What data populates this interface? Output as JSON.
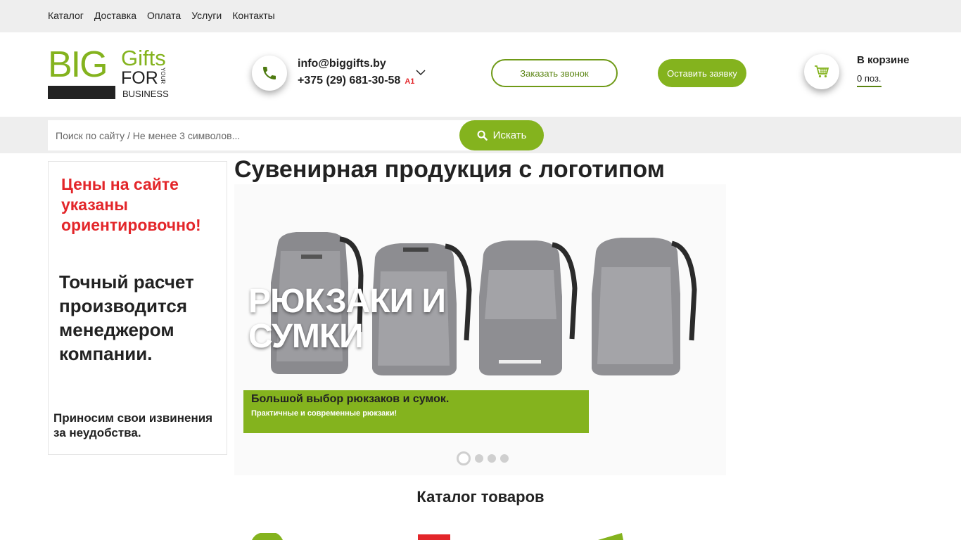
{
  "topnav": {
    "items": [
      "Каталог",
      "Доставка",
      "Оплата",
      "Услуги",
      "Контакты"
    ]
  },
  "logo": {
    "big": "BIG",
    "gifts": "Gifts",
    "for": "FOR",
    "your": "YOUR",
    "business": "BUSINESS"
  },
  "contact": {
    "email": "info@biggifts.by",
    "phone": "+375 (29) 681-30-58",
    "operator": "A1"
  },
  "buttons": {
    "callback": "Заказать звонок",
    "request": "Оставить заявку"
  },
  "cart": {
    "title": "В корзине",
    "count": "0 поз."
  },
  "search": {
    "placeholder": "Поиск по сайту / Не менее 3 символов...",
    "button": "Искать"
  },
  "side_banner": {
    "notice": "Цены на сайте указаны ориентировочно!",
    "detail": "Точный расчет производится менеджером компании.",
    "apology": "Приносим свои извинения за неудобства."
  },
  "page": {
    "title": "Сувенирная продукция с логотипом"
  },
  "slider": {
    "headline_line1": "РЮКЗАКИ И",
    "headline_line2": "СУМКИ",
    "strip_main": "Большой выбор рюкзаков и сумок.",
    "strip_sub": "Практичные и современные рюкзаки!",
    "active_slide": 1,
    "slide_count": 4
  },
  "catalog": {
    "title": "Каталог товаров"
  },
  "colors": {
    "accent": "#84b31e",
    "accent_dark": "#5b8513",
    "notice_red": "#e3262a",
    "bar_bg": "#eeeeee"
  }
}
